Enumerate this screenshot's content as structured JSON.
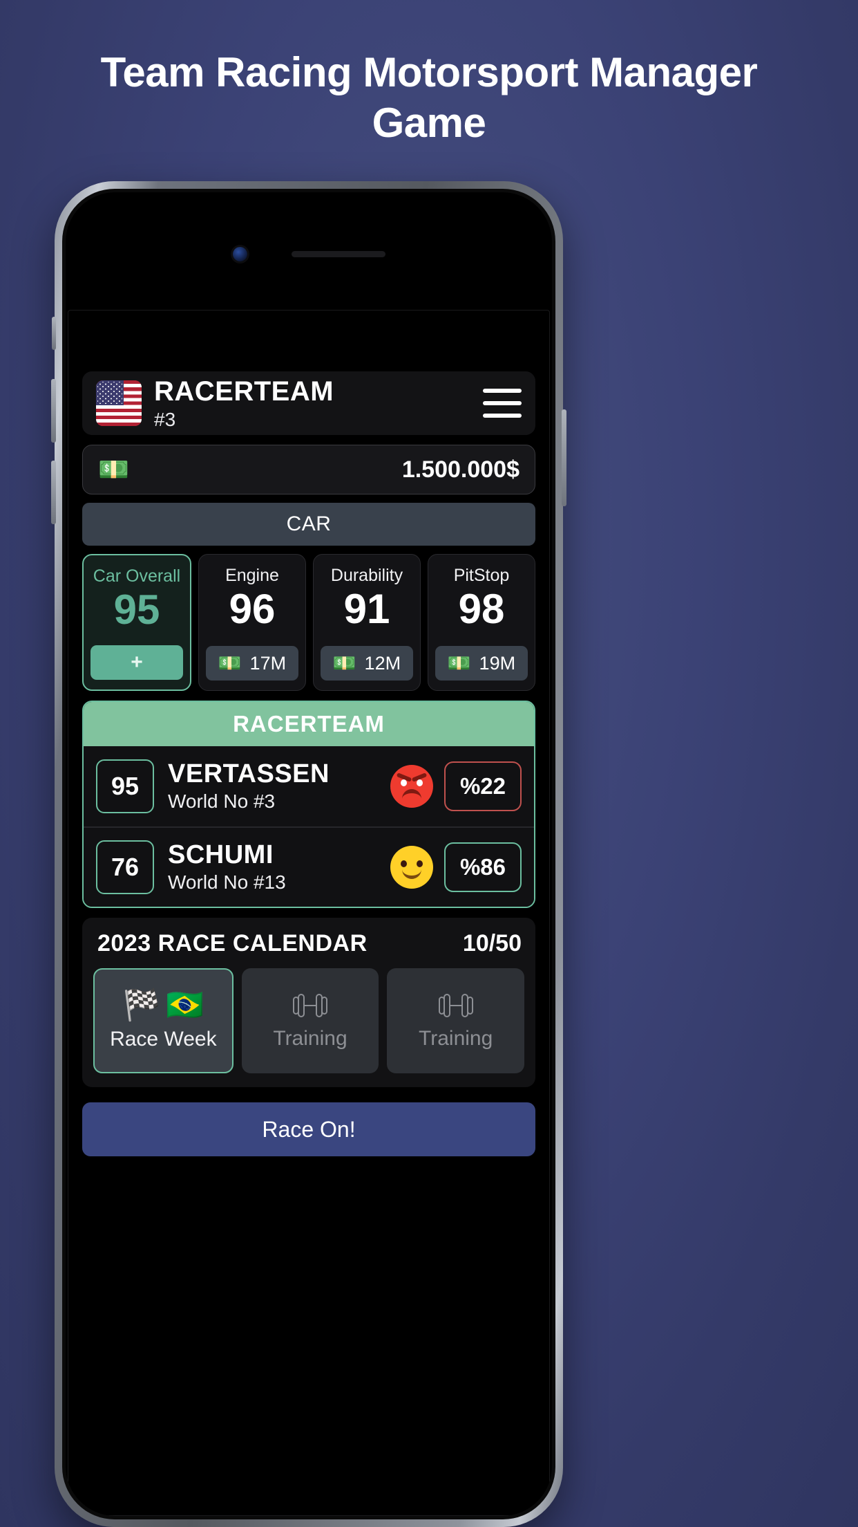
{
  "promo": {
    "headline": "Team Racing Motorsport Manager Game"
  },
  "app": {
    "team": {
      "flag_icon": "us-flag-icon",
      "name": "RACERTEAM",
      "rank": "#3",
      "menu_icon": "hamburger-menu-icon"
    },
    "money": {
      "icon": "cash-icon",
      "amount": "1.500.000$"
    },
    "car_section": {
      "title": "CAR",
      "stats": [
        {
          "label": "Car Overall",
          "value": "95",
          "action": "+",
          "primary": true
        },
        {
          "label": "Engine",
          "value": "96",
          "cost": "17M",
          "cost_icon": "cash-icon"
        },
        {
          "label": "Durability",
          "value": "91",
          "cost": "12M",
          "cost_icon": "cash-icon"
        },
        {
          "label": "PitStop",
          "value": "98",
          "cost": "19M",
          "cost_icon": "cash-icon"
        }
      ]
    },
    "drivers_panel": {
      "title": "RACERTEAM",
      "drivers": [
        {
          "overall": "95",
          "name": "VERTASSEN",
          "world_rank": "World No #3",
          "mood": "angry",
          "percent": "%22",
          "percent_state": "negative"
        },
        {
          "overall": "76",
          "name": "SCHUMI",
          "world_rank": "World No #13",
          "mood": "happy",
          "percent": "%86",
          "percent_state": "positive"
        }
      ]
    },
    "calendar": {
      "title": "2023 RACE CALENDAR",
      "count": "10/50",
      "items": [
        {
          "label": "Race Week",
          "icons": "checkered-flag-icon + brazil-flag-icon",
          "active": true
        },
        {
          "label": "Training",
          "icons": "dumbbell-icon",
          "active": false
        },
        {
          "label": "Training",
          "icons": "dumbbell-icon",
          "active": false
        }
      ]
    },
    "race_button": {
      "label": "Race On!"
    }
  },
  "colors": {
    "accent_green": "#6cbfa0",
    "header_green": "#81c39e",
    "danger_red": "#c0514e",
    "race_blue": "#3a4680",
    "background": "#3b4275"
  }
}
